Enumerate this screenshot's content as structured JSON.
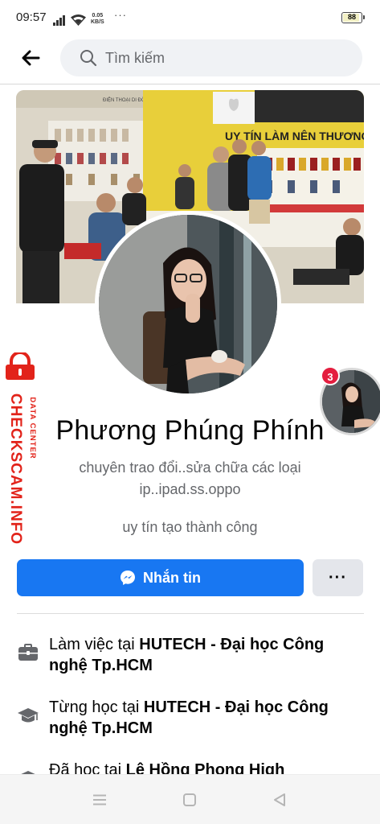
{
  "status_bar": {
    "time": "09:57",
    "net_speed_value": "0.05",
    "net_speed_unit": "KB/S",
    "overflow": "···",
    "battery": "88"
  },
  "header": {
    "search_placeholder": "Tìm kiếm"
  },
  "watermark": {
    "brand": "CHECKSCAM.INFO",
    "subtitle": "DATA CENTER"
  },
  "story": {
    "badge_count": "3"
  },
  "profile": {
    "name": "Phương Phúng Phính",
    "bio_line1": "chuyên trao đổi..sửa chữa các loại",
    "bio_line2": "ip..ipad.ss.oppo",
    "tagline": "uy tín tạo thành công"
  },
  "actions": {
    "message_label": "Nhắn tin",
    "more_label": "···"
  },
  "cover": {
    "store_sign": "UY TÍN LÀM NÊN THƯƠNG",
    "store_sign_small": "ĐIỆN THOẠI DI ĐỘNG"
  },
  "details": {
    "work": {
      "prefix": "Làm việc tại ",
      "place": "HUTECH - Đại học Công nghệ Tp.HCM"
    },
    "study1": {
      "prefix": "Từng học tại ",
      "place": "HUTECH - Đại học Công nghệ Tp.HCM"
    },
    "study2": {
      "prefix": "Đã học tại ",
      "place": "Lê Hồng Phong High"
    }
  },
  "colors": {
    "accent": "#1877f2",
    "watermark_red": "#e2231a",
    "badge_red": "#e41e3f"
  },
  "icons": {
    "back": "arrow-left-icon",
    "search": "search-icon",
    "messenger": "messenger-icon",
    "work": "briefcase-icon",
    "study": "graduation-cap-icon",
    "watermark": "padlock-icon"
  }
}
